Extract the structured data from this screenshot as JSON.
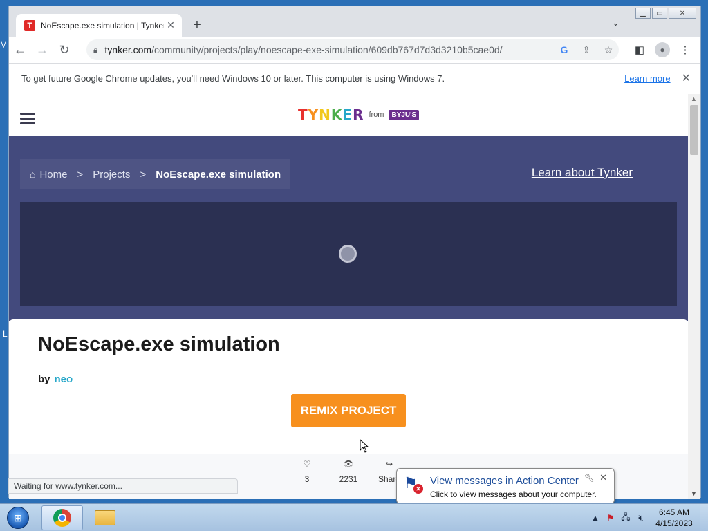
{
  "browser": {
    "tab_title": "NoEscape.exe simulation | Tynker",
    "tab_favicon": "T",
    "url_host": "tynker.com",
    "url_path": "/community/projects/play/noescape-exe-simulation/609db767d7d3d3210b5cae0d/",
    "infobar_text": "To get future Google Chrome updates, you'll need Windows 10 or later. This computer is using Windows 7.",
    "infobar_link": "Learn more",
    "status_text": "Waiting for www.tynker.com..."
  },
  "site": {
    "logo_text": "TYNKER",
    "logo_from": "from",
    "logo_brand": "BYJU'S",
    "breadcrumb": {
      "home": "Home",
      "projects": "Projects",
      "current": "NoEscape.exe simulation",
      "separator": ">"
    },
    "learn_link": "Learn about Tynker"
  },
  "project": {
    "title": "NoEscape.exe simulation",
    "by_label": "by",
    "author": "neo",
    "remix_label": "REMIX PROJECT",
    "stats": {
      "likes": "3",
      "views": "2231",
      "share_label": "Share"
    }
  },
  "notification": {
    "title": "View messages in Action Center",
    "subtitle": "Click to view messages about your computer."
  },
  "taskbar": {
    "time": "6:45 AM",
    "date": "4/15/2023"
  },
  "desktop": {
    "edge_letter_top": "M",
    "edge_letter_mid": "L"
  },
  "colors": {
    "hero_bg": "#434a7d",
    "player_bg": "#2b3052",
    "remix_button": "#f7901e",
    "author_link": "#26a7c9",
    "chrome_link": "#1a73e8"
  }
}
